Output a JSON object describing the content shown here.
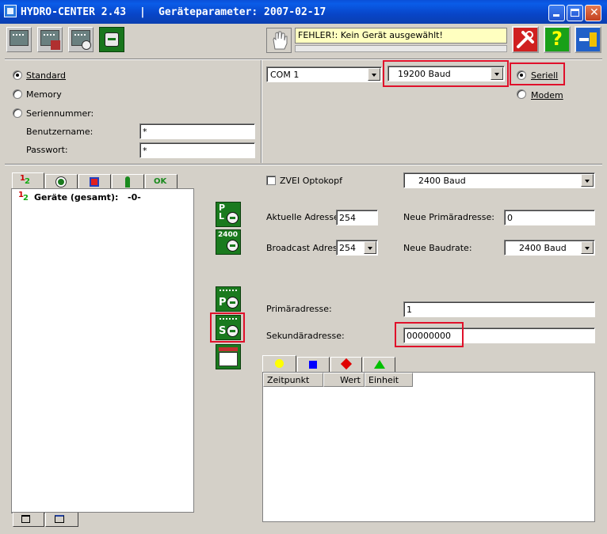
{
  "window": {
    "app_name": "HYDRO-CENTER 2.43",
    "separator": "|",
    "section": "Geräteparameter:",
    "date": "2007-02-17"
  },
  "toolbar": {
    "status_message": "FEHLER!: Kein Gerät ausgewählt!",
    "help_label": "?"
  },
  "login": {
    "mode_standard": "Standard",
    "mode_memory": "Memory",
    "mode_serial": "Seriennummer:",
    "selected_mode": "Standard",
    "username_label": "Benutzername:",
    "username_value": "*",
    "password_label": "Passwort:",
    "password_value": "*"
  },
  "connection": {
    "port": "COM  1",
    "baud": "19200 Baud",
    "iface_serial": "Seriell",
    "iface_modem": "Modem",
    "selected_iface": "Seriell"
  },
  "tree": {
    "root_label": "Geräte (gesamt):",
    "root_count": "-0-"
  },
  "params": {
    "zvei_label": "ZVEI Optokopf",
    "zvei_checked": false,
    "zvei_baud": "2400 Baud",
    "current_address_label": "Aktuelle Adresse:",
    "current_address": "254",
    "new_primary_label": "Neue Primäradresse:",
    "new_primary": "0",
    "broadcast_label": "Broadcast Adresse",
    "broadcast_value": "254",
    "new_baud_label": "Neue Baudrate:",
    "new_baud": "2400 Baud",
    "primary_label": "Primäradresse:",
    "primary_value": "1",
    "secondary_label": "Sekundäradresse:",
    "secondary_value": "00000000"
  },
  "side_buttons": {
    "pl_letters": "P\nL",
    "baud_letters": "2400",
    "p_letter": "P",
    "s_letter": "S"
  },
  "table": {
    "columns": [
      "Zeitpunkt",
      "Wert",
      "Einheit"
    ],
    "tab_colors": [
      "#ffff00",
      "#0000ff",
      "#e00000",
      "#00c000"
    ]
  }
}
